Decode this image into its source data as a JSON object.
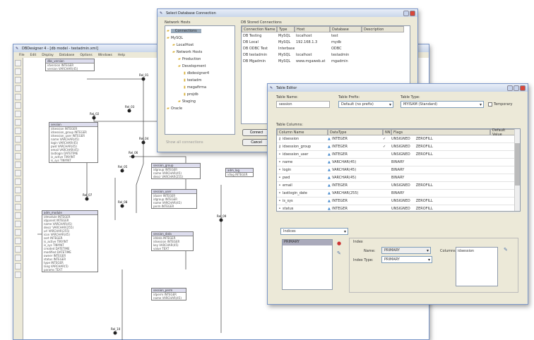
{
  "main_window": {
    "title": "DBDesigner 4 - [db model - testadmin.xml]",
    "menu": [
      "File",
      "Edit",
      "Display",
      "Database",
      "Options",
      "Windows",
      "Help"
    ],
    "diagram_tables": [
      {
        "name": "dbs_version",
        "rows": [
          "idversion INTEGER",
          "version VARCHAR(45)"
        ]
      },
      {
        "name": "session",
        "rows": [
          "idsession INTEGER",
          "idsession_group INTEGER",
          "idsession_user INTEGER",
          "name VARCHAR(45)",
          "login VARCHAR(45)",
          "pwd VARCHAR(45)",
          "email VARCHAR(45)",
          "lastlogin DATETIME",
          "is_active TINYINT",
          "is_sys TINYINT"
        ]
      },
      {
        "name": "session_group",
        "rows": [
          "idgroup INTEGER",
          "name VARCHAR(45)",
          "descr VARCHAR(255)"
        ]
      },
      {
        "name": "session_user",
        "rows": [
          "iduser INTEGER",
          "idgroup INTEGER",
          "name VARCHAR(45)",
          "perm INTEGER"
        ]
      },
      {
        "name": "session_data",
        "rows": [
          "iddata INTEGER",
          "idsession INTEGER",
          "key VARCHAR(45)",
          "value TEXT"
        ]
      },
      {
        "name": "session_perm",
        "rows": [
          "idperm INTEGER",
          "name VARCHAR(45)"
        ]
      },
      {
        "name": "adm_module",
        "rows": [
          "idmodule INTEGER",
          "idparent INTEGER",
          "name VARCHAR(45)",
          "descr VARCHAR(255)",
          "url VARCHAR(255)",
          "icon VARCHAR(45)",
          "sort INTEGER",
          "is_active TINYINT",
          "is_sys TINYINT",
          "created DATETIME",
          "modified DATETIME",
          "owner INTEGER",
          "status INTEGER",
          "type INTEGER",
          "lang VARCHAR(5)",
          "params TEXT"
        ]
      },
      {
        "name": "adm_log",
        "rows": [
          "idlog INTEGER"
        ]
      }
    ],
    "relations": [
      "Rel_01",
      "Rel_02",
      "Rel_03",
      "Rel_04",
      "Rel_05",
      "Rel_06",
      "Rel_07",
      "Rel_08",
      "Rel_09",
      "Rel_10"
    ]
  },
  "connection_dialog": {
    "title": "Select Database Connection",
    "tree_label": "Network Hosts",
    "tree": [
      "Connections",
      "MySQL",
      "LocalHost",
      "Network Hosts",
      "Production",
      "Development",
      "dbdesigner4",
      "testadm",
      "megafirma",
      "projdb",
      "Staging",
      "Oracle"
    ],
    "list_label": "DB Stored Connections",
    "columns": [
      "Connection Name",
      "Type",
      "Host",
      "Database",
      "Description"
    ],
    "rows": [
      [
        "DB Testing",
        "MySQL",
        "localhost",
        "test",
        ""
      ],
      [
        "DB Local",
        "MySQL",
        "192.168.1.3",
        "mydb",
        ""
      ],
      [
        "DB ODBC Test",
        "Interbase",
        "",
        "ODBC",
        ""
      ],
      [
        "DB testadmin",
        "MySQL",
        "localhost",
        "testadmin",
        ""
      ],
      [
        "DB Mgadmin",
        "MySQL",
        "www.mgaweb.at",
        "mgadmin",
        ""
      ]
    ],
    "buttons": [
      "Connect",
      "Cancel"
    ],
    "footer": "Show all connections"
  },
  "table_editor": {
    "title": "Table Editor",
    "table_name_label": "Table Name:",
    "table_name": "session",
    "prefix_label": "Table Prefix:",
    "prefix": "Default (no prefix)",
    "type_label": "Table Type:",
    "type": "MYISAM (Standard)",
    "temporary_label": "Temporary",
    "columns_label": "Table Columns:",
    "columns": [
      "Column Name",
      "DataType",
      "NN",
      "Flags",
      "Default Value"
    ],
    "rows": [
      {
        "name": "idsession",
        "type": "INTEGER",
        "nn": "✓",
        "flags": [
          "UNSIGNED",
          "ZEROFILL"
        ]
      },
      {
        "name": "idsession_group",
        "type": "INTEGER",
        "nn": "✓",
        "flags": [
          "UNSIGNED",
          "ZEROFILL"
        ]
      },
      {
        "name": "idsession_user",
        "type": "INTEGER",
        "nn": "",
        "flags": [
          "UNSIGNED",
          "ZEROFILL"
        ]
      },
      {
        "name": "name",
        "type": "VARCHAR(45)",
        "nn": "",
        "flags": [
          "BINARY"
        ]
      },
      {
        "name": "login",
        "type": "VARCHAR(45)",
        "nn": "",
        "flags": [
          "BINARY"
        ]
      },
      {
        "name": "pwd",
        "type": "VARCHAR(45)",
        "nn": "",
        "flags": [
          "BINARY"
        ]
      },
      {
        "name": "email",
        "type": "INTEGER",
        "nn": "",
        "flags": [
          "UNSIGNED",
          "ZEROFILL"
        ]
      },
      {
        "name": "lastlogin_date",
        "type": "VARCHAR(255)",
        "nn": "",
        "flags": [
          "BINARY"
        ]
      },
      {
        "name": "is_sys",
        "type": "INTEGER",
        "nn": "",
        "flags": [
          "UNSIGNED",
          "ZEROFILL"
        ]
      },
      {
        "name": "status",
        "type": "INTEGER",
        "nn": "",
        "flags": [
          "UNSIGNED",
          "ZEROFILL"
        ]
      }
    ],
    "section_select": "Indices",
    "indices": [
      "PRIMARY"
    ],
    "index_group": "Index",
    "index_name_label": "Name:",
    "index_name": "PRIMARY",
    "index_type_label": "Index Type:",
    "index_type": "PRIMARY",
    "columns_list_label": "Columns:",
    "index_columns": [
      "idsession"
    ]
  }
}
